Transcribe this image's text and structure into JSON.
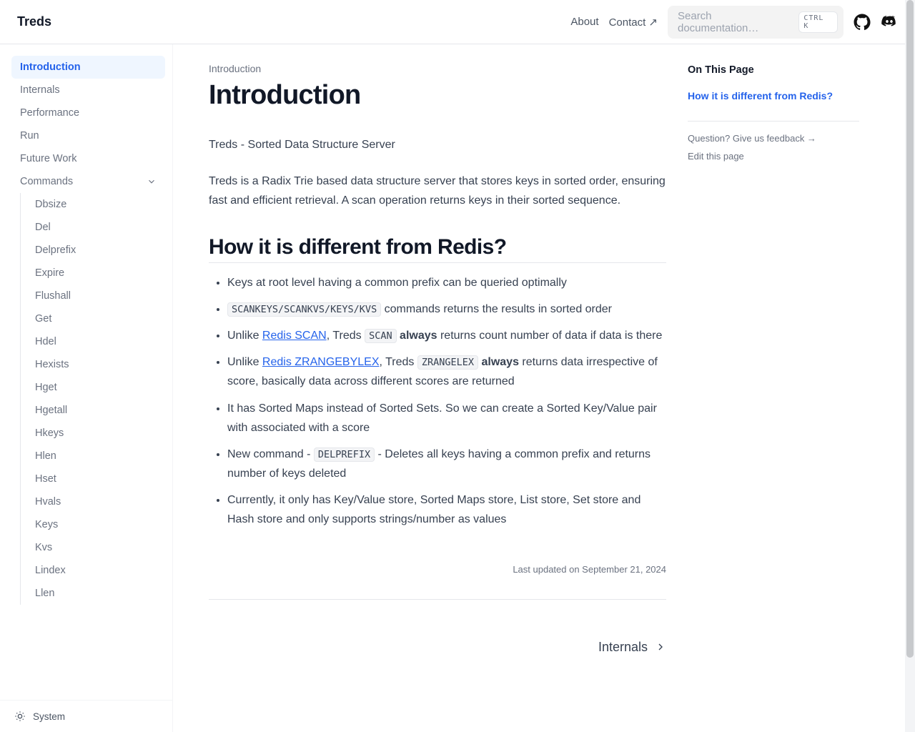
{
  "header": {
    "brand": "Treds",
    "nav": {
      "about": "About",
      "contact": "Contact ↗"
    },
    "search_placeholder": "Search documentation…",
    "search_kbd": "CTRL K"
  },
  "sidebar": {
    "items": [
      {
        "label": "Introduction",
        "active": true
      },
      {
        "label": "Internals"
      },
      {
        "label": "Performance"
      },
      {
        "label": "Run"
      },
      {
        "label": "Future Work"
      },
      {
        "label": "Commands",
        "expandable": true
      }
    ],
    "commands": [
      "Dbsize",
      "Del",
      "Delprefix",
      "Expire",
      "Flushall",
      "Get",
      "Hdel",
      "Hexists",
      "Hget",
      "Hgetall",
      "Hkeys",
      "Hlen",
      "Hset",
      "Hvals",
      "Keys",
      "Kvs",
      "Lindex",
      "Llen"
    ],
    "footer": "System"
  },
  "article": {
    "breadcrumb": "Introduction",
    "h1": "Introduction",
    "p1": "Treds - Sorted Data Structure Server",
    "p2": "Treds is a Radix Trie based data structure server that stores keys in sorted order, ensuring fast and efficient retrieval. A scan operation returns keys in their sorted sequence.",
    "h2": "How it is different from Redis?",
    "b1": "Keys at root level having a common prefix can be queried optimally",
    "b2_code": "SCANKEYS/SCANKVS/KEYS/KVS",
    "b2_rest": " commands returns the results in sorted order",
    "b3_pre": "Unlike ",
    "b3_link": "Redis SCAN",
    "b3_mid": ", Treds ",
    "b3_code": "SCAN",
    "b3_bold": "always",
    "b3_rest": " returns count number of data if data is there",
    "b4_pre": "Unlike ",
    "b4_link": "Redis ZRANGEBYLEX",
    "b4_mid": ", Treds ",
    "b4_code": "ZRANGELEX",
    "b4_bold": "always",
    "b4_rest": " returns data irrespective of score, basically data across different scores are returned",
    "b5": "It has Sorted Maps instead of Sorted Sets. So we can create a Sorted Key/Value pair with associated with a score",
    "b6_pre": "New command - ",
    "b6_code": "DELPREFIX",
    "b6_rest": " - Deletes all keys having a common prefix and returns number of keys deleted",
    "b7": "Currently, it only has Key/Value store, Sorted Maps store, List store, Set store and Hash store and only supports strings/number as values",
    "last_updated": "Last updated on September 21, 2024",
    "next": "Internals"
  },
  "toc": {
    "title": "On This Page",
    "link1": "How it is different from Redis?",
    "feedback": "Question? Give us feedback →",
    "edit": "Edit this page"
  }
}
